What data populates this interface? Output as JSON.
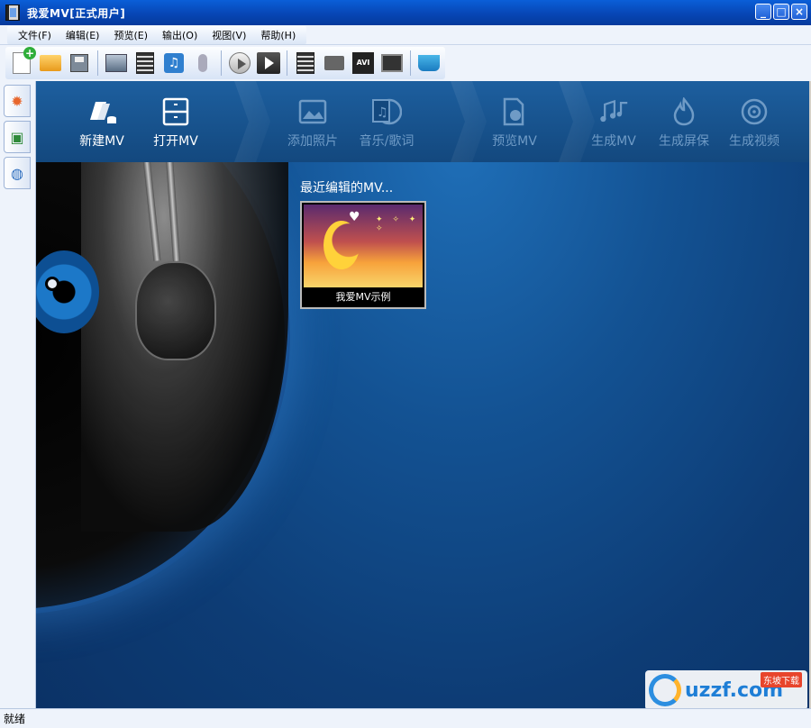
{
  "window": {
    "title": "我爱MV[正式用户]"
  },
  "menu": {
    "items": [
      {
        "label": "文件(F)"
      },
      {
        "label": "编辑(E)"
      },
      {
        "label": "预览(E)"
      },
      {
        "label": "输出(O)"
      },
      {
        "label": "视图(V)"
      },
      {
        "label": "帮助(H)"
      }
    ]
  },
  "toolbar": {
    "icons": [
      "new-project-icon",
      "open-folder-icon",
      "save-icon",
      "add-photo-icon",
      "add-film-icon",
      "music-icon",
      "microphone-icon",
      "play-icon",
      "play-full-icon",
      "film-strip-icon",
      "camera-icon",
      "avi-icon",
      "monitor-icon",
      "cart-icon"
    ],
    "avi_text": "AVI"
  },
  "nav": {
    "new_mv": "新建MV",
    "open_mv": "打开MV",
    "add_photo": "添加照片",
    "music_lyrics": "音乐/歌词",
    "preview_mv": "预览MV",
    "generate_mv": "生成MV",
    "generate_screensaver": "生成屏保",
    "generate_video": "生成视频"
  },
  "recent": {
    "title": "最近编辑的MV...",
    "items": [
      {
        "caption": "我爱MV示例"
      }
    ]
  },
  "watermark": {
    "text": "uzzf.com",
    "sub": "东坡下载"
  },
  "status": {
    "text": "就绪"
  }
}
